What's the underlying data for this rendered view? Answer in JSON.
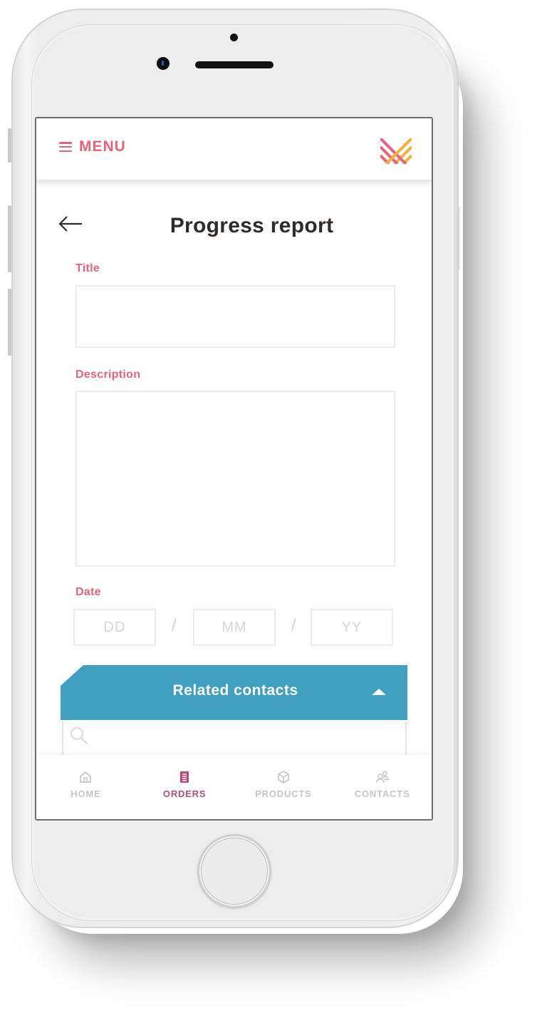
{
  "header": {
    "menu_label": "MENU",
    "menu_icon": "hamburger-icon",
    "logo_icon": "woven-lines-logo",
    "colors": {
      "accent": "#e8637a",
      "logo_secondary": "#f4b03a"
    }
  },
  "page": {
    "title": "Progress report",
    "back_icon": "arrow-left-icon"
  },
  "form": {
    "title_label": "Title",
    "title_value": "",
    "description_label": "Description",
    "description_value": "",
    "date_label": "Date",
    "date_day_placeholder": "DD",
    "date_month_placeholder": "MM",
    "date_year_placeholder": "YY",
    "date_separator": "/"
  },
  "related_contacts": {
    "title": "Related contacts",
    "expanded": true,
    "toggle_icon": "caret-up-icon",
    "search_icon": "search-icon",
    "search_value": "",
    "color": "#419fbf"
  },
  "bottom_nav": {
    "items": [
      {
        "label": "HOME",
        "icon": "home-icon",
        "active": false
      },
      {
        "label": "ORDERS",
        "icon": "document-icon",
        "active": true
      },
      {
        "label": "PRODUCTS",
        "icon": "box-icon",
        "active": false
      },
      {
        "label": "CONTACTS",
        "icon": "people-icon",
        "active": false
      }
    ],
    "active_color": "#b44d7c",
    "inactive_color": "#c7c7c7"
  }
}
